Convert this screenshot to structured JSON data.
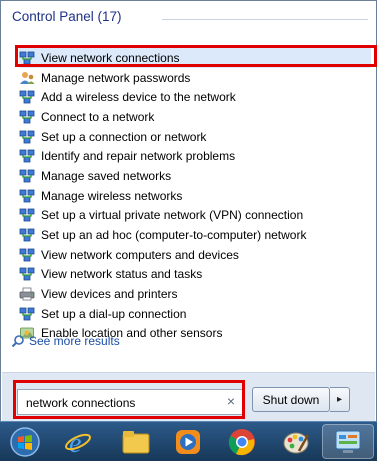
{
  "results": {
    "section_title": "Control Panel (17)",
    "items": [
      {
        "label": "View network connections",
        "icon": "network-icon",
        "selected": true
      },
      {
        "label": "Manage network passwords",
        "icon": "user-accounts-icon",
        "selected": false
      },
      {
        "label": "Add a wireless device to the network",
        "icon": "network-icon",
        "selected": false
      },
      {
        "label": "Connect to a network",
        "icon": "network-icon",
        "selected": false
      },
      {
        "label": "Set up a connection or network",
        "icon": "network-icon",
        "selected": false
      },
      {
        "label": "Identify and repair network problems",
        "icon": "network-icon",
        "selected": false
      },
      {
        "label": "Manage saved networks",
        "icon": "network-icon",
        "selected": false
      },
      {
        "label": "Manage wireless networks",
        "icon": "network-icon",
        "selected": false
      },
      {
        "label": "Set up a virtual private network (VPN) connection",
        "icon": "network-icon",
        "selected": false
      },
      {
        "label": "Set up an ad hoc (computer-to-computer) network",
        "icon": "network-icon",
        "selected": false
      },
      {
        "label": "View network computers and devices",
        "icon": "network-icon",
        "selected": false
      },
      {
        "label": "View network status and tasks",
        "icon": "network-icon",
        "selected": false
      },
      {
        "label": "View devices and printers",
        "icon": "printer-icon",
        "selected": false
      },
      {
        "label": "Set up a dial-up connection",
        "icon": "network-icon",
        "selected": false
      },
      {
        "label": "Enable location and other sensors",
        "icon": "sensor-icon",
        "selected": false
      }
    ],
    "see_more": "See more results"
  },
  "search": {
    "value": "network connections",
    "clear_symbol": "×"
  },
  "power": {
    "shutdown_label": "Shut down",
    "arrow_symbol": "▸"
  },
  "taskbar": {
    "items": [
      "start-orb-icon",
      "internet-explorer-icon",
      "file-explorer-icon",
      "media-player-icon",
      "chrome-icon",
      "paint-icon",
      "control-panel-icon"
    ]
  },
  "colors": {
    "highlight": "#e00000",
    "link": "#1a4ea7",
    "section_title": "#1e3287"
  }
}
